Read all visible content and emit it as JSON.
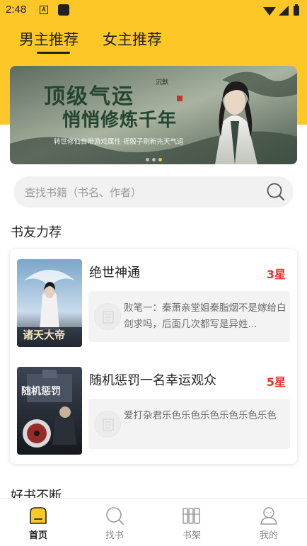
{
  "status_bar": {
    "time": "2:48",
    "notif_icon_letter": "A"
  },
  "tabs": [
    {
      "label": "男主推荐",
      "active": true
    },
    {
      "label": "女主推荐",
      "active": false
    }
  ],
  "banner": {
    "title_line1": "顶级气运",
    "title_line2": "悄悄修炼千年",
    "tagline": "转世修仙自带游戏属性·摇骰子刷新先天气运",
    "author_tag": "沉默",
    "dots_count": 3,
    "active_dot": 2
  },
  "search": {
    "placeholder": "查找书籍（书名、作者）"
  },
  "sections": {
    "recommend_title": "书友力荐",
    "more_title": "好书不断"
  },
  "books": [
    {
      "title": "绝世神通",
      "stars": "3星",
      "comment": "败笔一：秦萧亲堂姐秦脂烟不是嫁给白剑求吗，后面几次都写是异姓...",
      "cover_text": "诸天大帝"
    },
    {
      "title": "随机惩罚一名幸运观众",
      "stars": "5星",
      "comment": "爱打杂君乐色乐色乐色乐色乐色乐色",
      "cover_text": "随机惩罚"
    }
  ],
  "bottom_nav": [
    {
      "label": "首页",
      "icon": "home-icon",
      "active": true
    },
    {
      "label": "找书",
      "icon": "search-icon",
      "active": false
    },
    {
      "label": "书架",
      "icon": "bookshelf-icon",
      "active": false
    },
    {
      "label": "我的",
      "icon": "profile-icon",
      "active": false
    }
  ],
  "colors": {
    "accent": "#fcc727",
    "stars": "#e8322a"
  }
}
